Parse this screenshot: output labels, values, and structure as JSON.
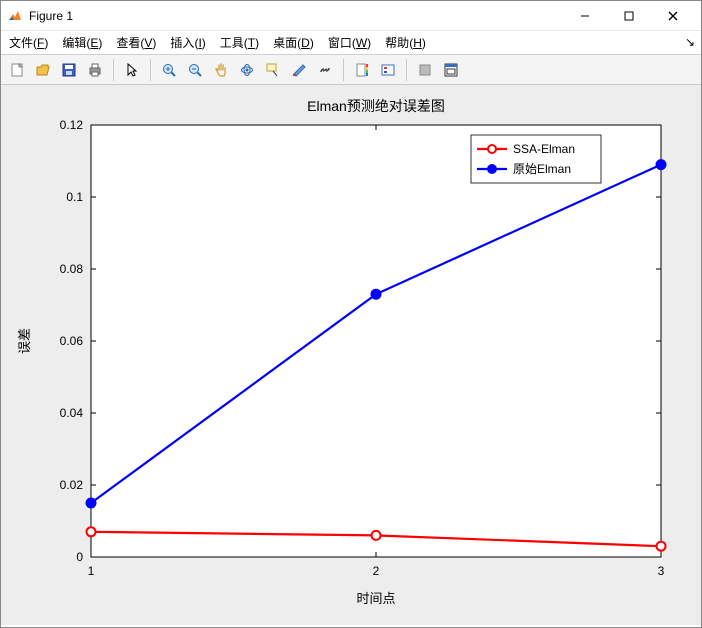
{
  "window": {
    "title": "Figure 1"
  },
  "menu": {
    "file": {
      "label": "文件",
      "key": "F"
    },
    "edit": {
      "label": "编辑",
      "key": "E"
    },
    "view": {
      "label": "查看",
      "key": "V"
    },
    "insert": {
      "label": "插入",
      "key": "I"
    },
    "tools": {
      "label": "工具",
      "key": "T"
    },
    "desktop": {
      "label": "桌面",
      "key": "D"
    },
    "window": {
      "label": "窗口",
      "key": "W"
    },
    "help": {
      "label": "帮助",
      "key": "H"
    }
  },
  "toolbar_icons": {
    "new": "新建",
    "open": "打开",
    "save": "保存",
    "print": "打印",
    "pointer": "指针",
    "zoom_in": "放大",
    "zoom_out": "缩小",
    "pan": "平移",
    "rotate": "旋转",
    "datatip": "数据提示",
    "brush": "刷选",
    "link": "联动",
    "colorbar": "颜色栏",
    "legend": "图例",
    "hide": "隐藏",
    "dock": "停靠"
  },
  "chart_data": {
    "type": "line",
    "title": "Elman预测绝对误差图",
    "xlabel": "时间点",
    "ylabel": "误差",
    "x": [
      1,
      2,
      3
    ],
    "xticks": [
      1,
      2,
      3
    ],
    "yticks": [
      0,
      0.02,
      0.04,
      0.06,
      0.08,
      0.1,
      0.12
    ],
    "xlim": [
      1,
      3
    ],
    "ylim": [
      0,
      0.12
    ],
    "legend_position": "top-right",
    "series": [
      {
        "name": "SSA-Elman",
        "color": "#ff0000",
        "marker": "o-open",
        "values": [
          0.007,
          0.006,
          0.003
        ]
      },
      {
        "name": "原始Elman",
        "color": "#0000ff",
        "marker": "o-filled",
        "values": [
          0.015,
          0.073,
          0.109
        ]
      }
    ]
  }
}
